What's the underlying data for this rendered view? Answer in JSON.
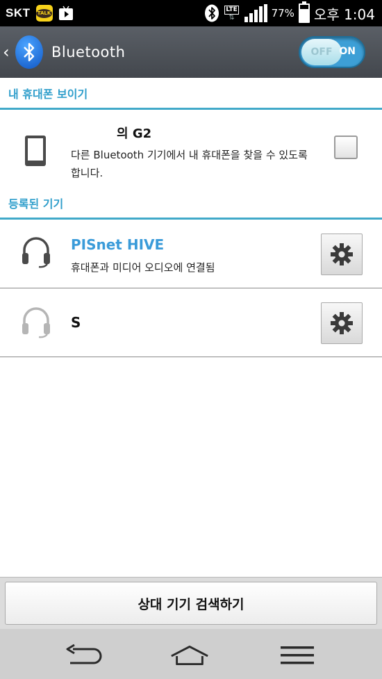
{
  "status_bar": {
    "carrier": "SKT",
    "talk_badge": "TALK",
    "lte_label": "LTE",
    "battery_percent": "77%",
    "battery_level": 0.77,
    "time": "오후 1:04"
  },
  "action_bar": {
    "title": "Bluetooth",
    "toggle_off": "OFF",
    "toggle_on": "ON",
    "toggle_state": "on"
  },
  "my_phone_section": {
    "header": "내 휴대폰 보이기",
    "device_name": "의 G2",
    "description": "다른 Bluetooth 기기에서 내 휴대폰을 찾을 수 있도록 합니다.",
    "checked": false
  },
  "paired_section": {
    "header": "등록된 기기",
    "devices": [
      {
        "name": "PISnet HIVE",
        "status": "휴대폰과 미디어 오디오에 연결됨",
        "connected": true
      },
      {
        "name": "S",
        "status": "",
        "connected": false
      }
    ]
  },
  "search_button": {
    "label": "상대 기기 검색하기"
  },
  "colors": {
    "accent": "#2f9ecb",
    "device_connected": "#3a9bd9",
    "toggle_on": "#3d9fd6"
  },
  "icons": {
    "back": "chevron-left-icon",
    "bluetooth": "bluetooth-icon",
    "phone": "phone-icon",
    "headset": "headset-icon",
    "settings": "gear-icon",
    "nav_back": "back-arrow-icon",
    "nav_home": "home-icon",
    "nav_menu": "menu-icon"
  }
}
